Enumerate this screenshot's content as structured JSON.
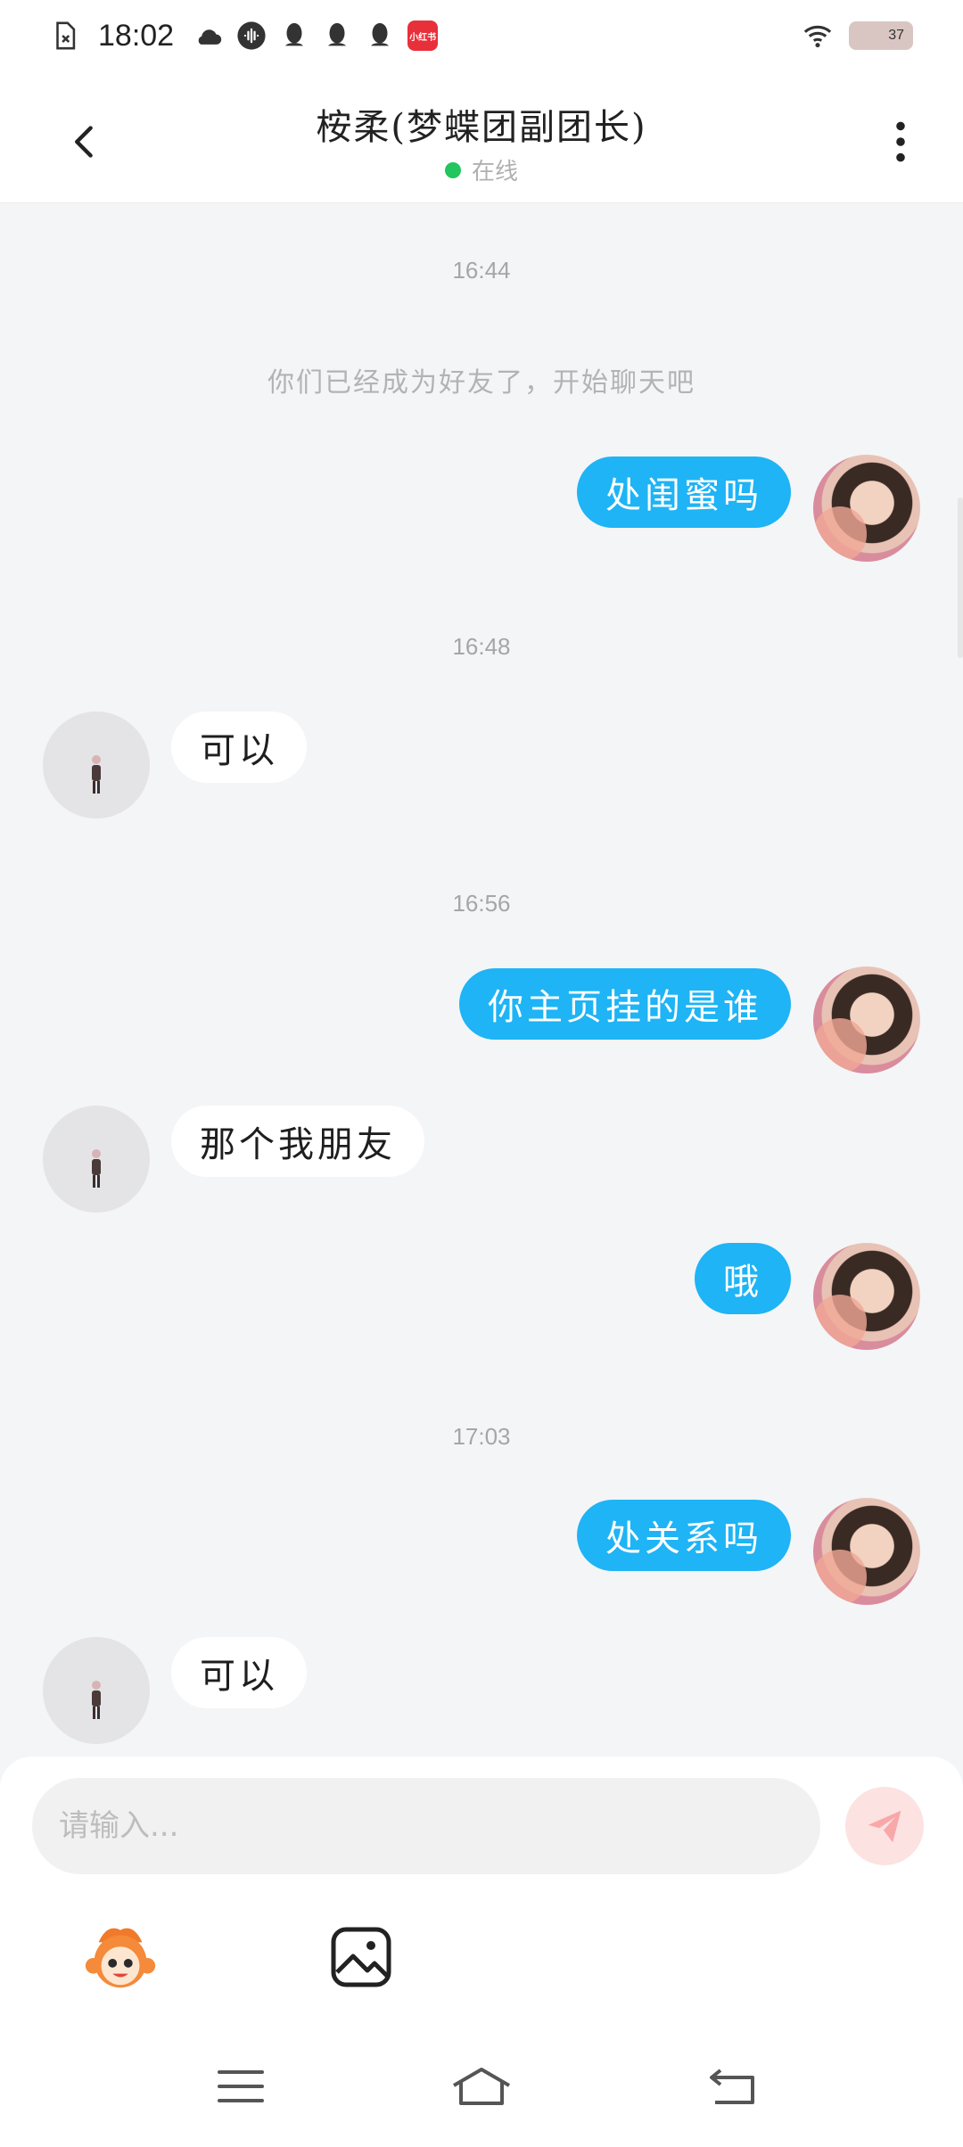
{
  "status_bar": {
    "time": "18:02",
    "icons": [
      "file-x-icon",
      "cloud-icon",
      "voice-icon",
      "qq-icon",
      "qq-icon",
      "qq-icon",
      "xiaohongshu-icon"
    ],
    "xiaohongshu_label": "小红书",
    "battery": "37"
  },
  "header": {
    "title": "桉柔(梦蝶团副团长)",
    "status": "在线"
  },
  "chat": {
    "timestamps": [
      "16:44",
      "16:48",
      "16:56",
      "17:03"
    ],
    "system_message": "你们已经成为好友了，开始聊天吧",
    "messages": [
      {
        "from": "self",
        "text": "处闺蜜吗"
      },
      {
        "from": "other",
        "text": "可以"
      },
      {
        "from": "self",
        "text": "你主页挂的是谁"
      },
      {
        "from": "other",
        "text": "那个我朋友"
      },
      {
        "from": "self",
        "text": "哦"
      },
      {
        "from": "self",
        "text": "处关系吗"
      },
      {
        "from": "other",
        "text": "可以"
      }
    ]
  },
  "composer": {
    "placeholder": "请输入...",
    "send_color": "#f8a8a8"
  },
  "colors": {
    "self_bubble": "#1eb4f5",
    "other_bubble": "#ffffff",
    "online_dot": "#22c55e",
    "background": "#f4f5f7"
  }
}
